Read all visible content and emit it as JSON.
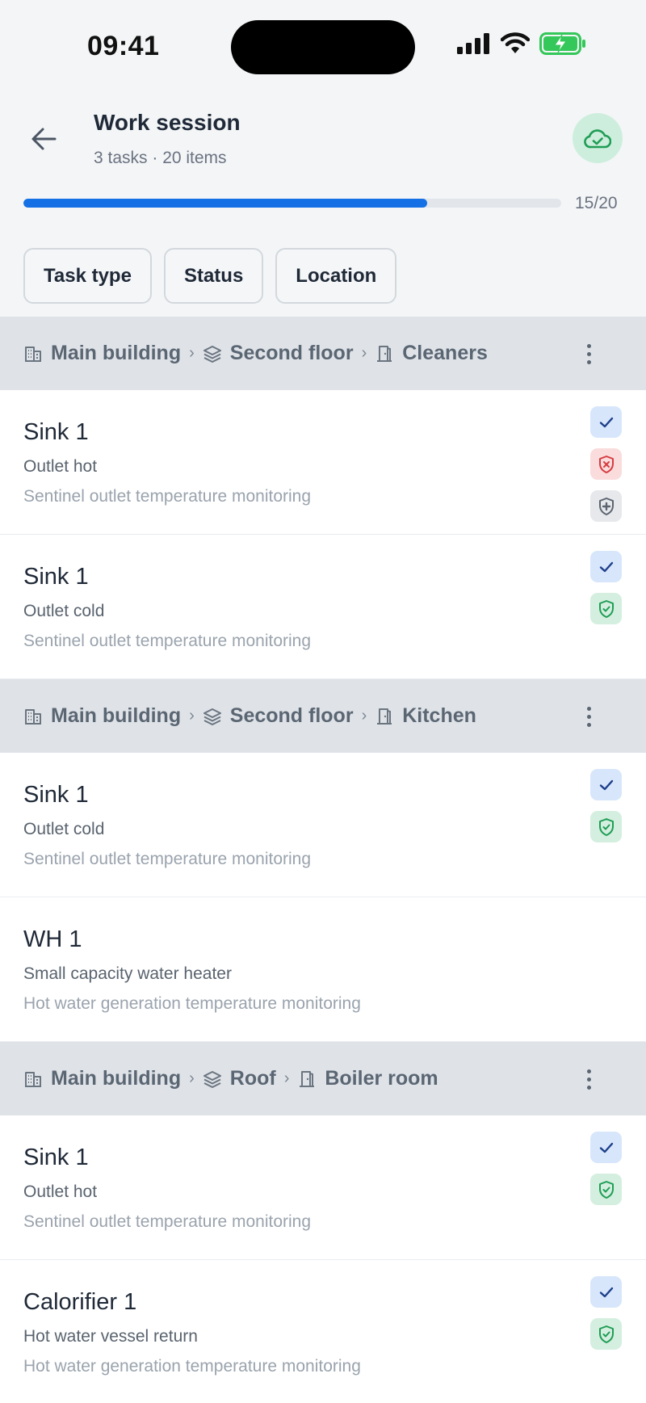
{
  "status_bar": {
    "time": "09:41"
  },
  "header": {
    "title": "Work session",
    "subtitle": "3 tasks · 20 items"
  },
  "progress": {
    "done": 15,
    "total": 20,
    "fraction": 0.75,
    "label": "15/20"
  },
  "filters": [
    "Task type",
    "Status",
    "Location"
  ],
  "colors": {
    "accent": "#1570e6",
    "success": "#1f9d55",
    "danger": "#e0484d",
    "group_bg": "#dfe3e8"
  },
  "groups": [
    {
      "building": "Main building",
      "floor": "Second floor",
      "room": "Cleaners",
      "items": [
        {
          "name": "Sink 1",
          "outlet": "Outlet hot",
          "task": "Sentinel outlet temperature monitoring",
          "badges": [
            "check-icon",
            "shield-x-icon",
            "shield-plus-icon"
          ]
        },
        {
          "name": "Sink 1",
          "outlet": "Outlet cold",
          "task": "Sentinel outlet temperature monitoring",
          "badges": [
            "check-icon",
            "shield-check-icon"
          ]
        }
      ]
    },
    {
      "building": "Main building",
      "floor": "Second floor",
      "room": "Kitchen",
      "items": [
        {
          "name": "Sink 1",
          "outlet": "Outlet cold",
          "task": "Sentinel outlet temperature monitoring",
          "badges": [
            "check-icon",
            "shield-check-icon"
          ]
        },
        {
          "name": "WH 1",
          "outlet": "Small capacity water heater",
          "task": "Hot water generation temperature monitoring",
          "badges": []
        }
      ]
    },
    {
      "building": "Main building",
      "floor": "Roof",
      "room": "Boiler room",
      "items": [
        {
          "name": "Sink 1",
          "outlet": "Outlet hot",
          "task": "Sentinel outlet temperature monitoring",
          "badges": [
            "check-icon",
            "shield-check-icon"
          ]
        },
        {
          "name": "Calorifier 1",
          "outlet": "Hot water vessel return",
          "task": "Hot water generation temperature monitoring",
          "badges": [
            "check-icon",
            "shield-check-icon"
          ]
        }
      ]
    }
  ]
}
